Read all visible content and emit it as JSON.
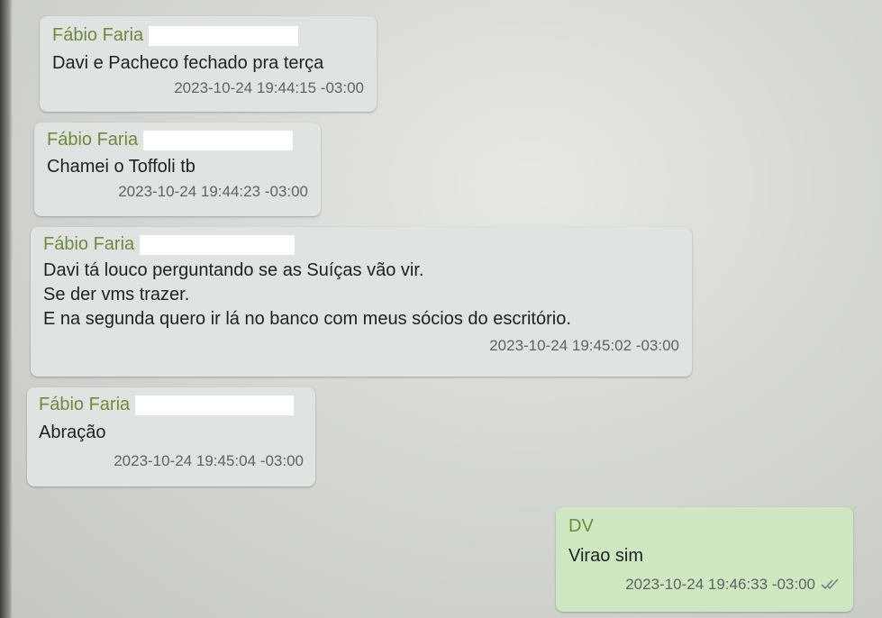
{
  "messages": [
    {
      "sender": "Fábio Faria",
      "lines": [
        "Davi e Pacheco fechado pra terça"
      ],
      "time": "2023-10-24 19:44:15 -03:00"
    },
    {
      "sender": "Fábio Faria",
      "lines": [
        "Chamei o Toffoli tb"
      ],
      "time": "2023-10-24 19:44:23 -03:00"
    },
    {
      "sender": "Fábio Faria",
      "lines": [
        "Davi tá louco perguntando se as Suíças vão vir.",
        "Se der vms trazer.",
        "E na segunda quero ir lá no banco com meus sócios do escritório."
      ],
      "time": "2023-10-24 19:45:02 -03:00"
    },
    {
      "sender": "Fábio Faria",
      "lines": [
        "Abração"
      ],
      "time": "2023-10-24 19:45:04 -03:00"
    },
    {
      "sender": "DV",
      "lines": [
        "Virao sim"
      ],
      "time": "2023-10-24 19:46:33 -03:00",
      "status_icon": "double-check-icon"
    }
  ],
  "colors": {
    "sender_name": "#6f8a3c",
    "incoming_bubble": "#dfe3e1",
    "outgoing_bubble": "#cfe8c2"
  }
}
